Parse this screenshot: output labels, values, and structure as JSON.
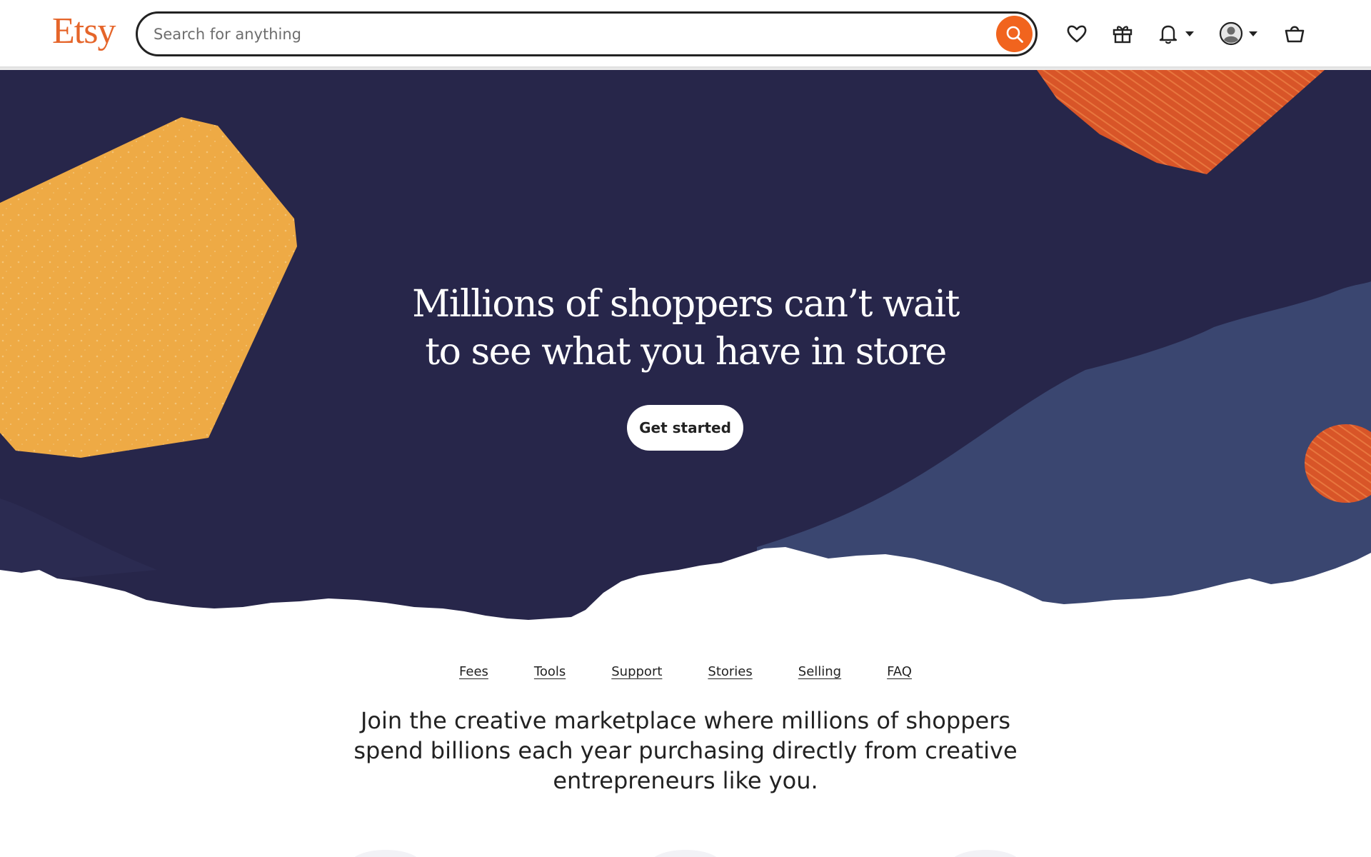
{
  "header": {
    "logo": "Etsy",
    "search": {
      "placeholder": "Search for anything",
      "value": ""
    },
    "icons": [
      "heart-icon",
      "gift-icon",
      "bell-icon",
      "account-icon",
      "cart-icon"
    ],
    "accent": "#f1641e",
    "logo_color": "#e5652a"
  },
  "hero": {
    "title_line1": "Millions of shoppers can’t wait",
    "title_line2": "to see what you have in store",
    "cta_label": "Get started",
    "colors": {
      "background": "#27264a",
      "yellow": "#eeaa45",
      "orange": "#d9572a",
      "blue": "#3a4670"
    }
  },
  "subnav": {
    "links": [
      "Fees",
      "Tools",
      "Support",
      "Stories",
      "Selling",
      "FAQ"
    ]
  },
  "lead": {
    "line1": "Join the creative marketplace where millions of shoppers",
    "line2": "spend billions each year purchasing directly from creative",
    "line3": "entrepreneurs like you."
  }
}
